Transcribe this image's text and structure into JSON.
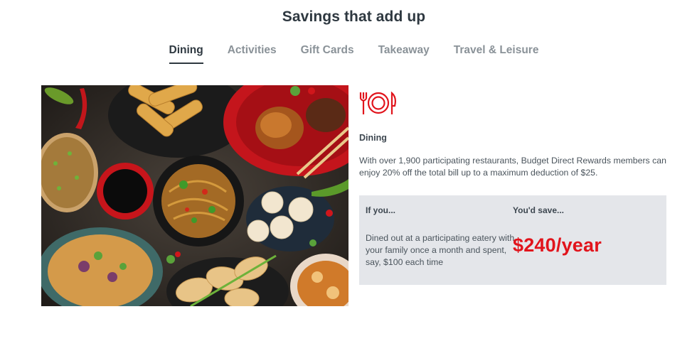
{
  "page": {
    "title": "Savings that add up"
  },
  "tabs": [
    {
      "label": "Dining",
      "active": true
    },
    {
      "label": "Activities",
      "active": false
    },
    {
      "label": "Gift Cards",
      "active": false
    },
    {
      "label": "Takeaway",
      "active": false
    },
    {
      "label": "Travel & Leisure",
      "active": false
    }
  ],
  "category": {
    "icon": "cutlery-plate-icon",
    "label": "Dining",
    "description": "With over 1,900 participating restaurants, Budget Direct Rewards members can enjoy 20% off the total bill up to a maximum deduction of $25."
  },
  "savings": {
    "if_header": "If you...",
    "save_header": "You'd save...",
    "scenario": "Dined out at a participating eatery with your family once a month and spent, say, $100 each time",
    "amount": "$240/year"
  },
  "colors": {
    "accent": "#e1141c",
    "panel": "#e4e6ea",
    "text": "#3d4750"
  }
}
